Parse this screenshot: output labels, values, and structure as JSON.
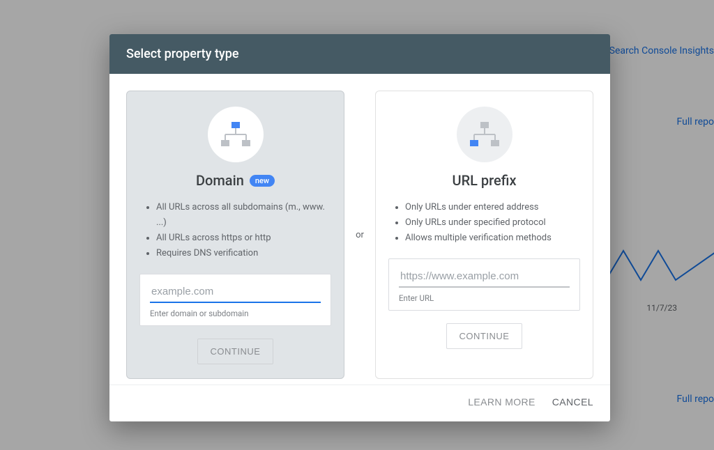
{
  "dialog": {
    "title": "Select property type",
    "divider": "or",
    "domain_card": {
      "title": "Domain",
      "badge": "new",
      "features": [
        "All URLs across all subdomains (m., www. ...)",
        "All URLs across https or http",
        "Requires DNS verification"
      ],
      "input_placeholder": "example.com",
      "input_value": "",
      "helper": "Enter domain or subdomain",
      "button": "CONTINUE"
    },
    "url_card": {
      "title": "URL prefix",
      "features": [
        "Only URLs under entered address",
        "Only URLs under specified protocol",
        "Allows multiple verification methods"
      ],
      "input_placeholder": "https://www.example.com",
      "input_value": "",
      "helper": "Enter URL",
      "button": "CONTINUE"
    },
    "footer": {
      "learn_more": "LEARN MORE",
      "cancel": "CANCEL"
    }
  },
  "background": {
    "link_insights": "Search Console Insights",
    "link_full_report_1": "Full repo",
    "link_full_report_2": "Full repo",
    "date": "11/7/23"
  }
}
